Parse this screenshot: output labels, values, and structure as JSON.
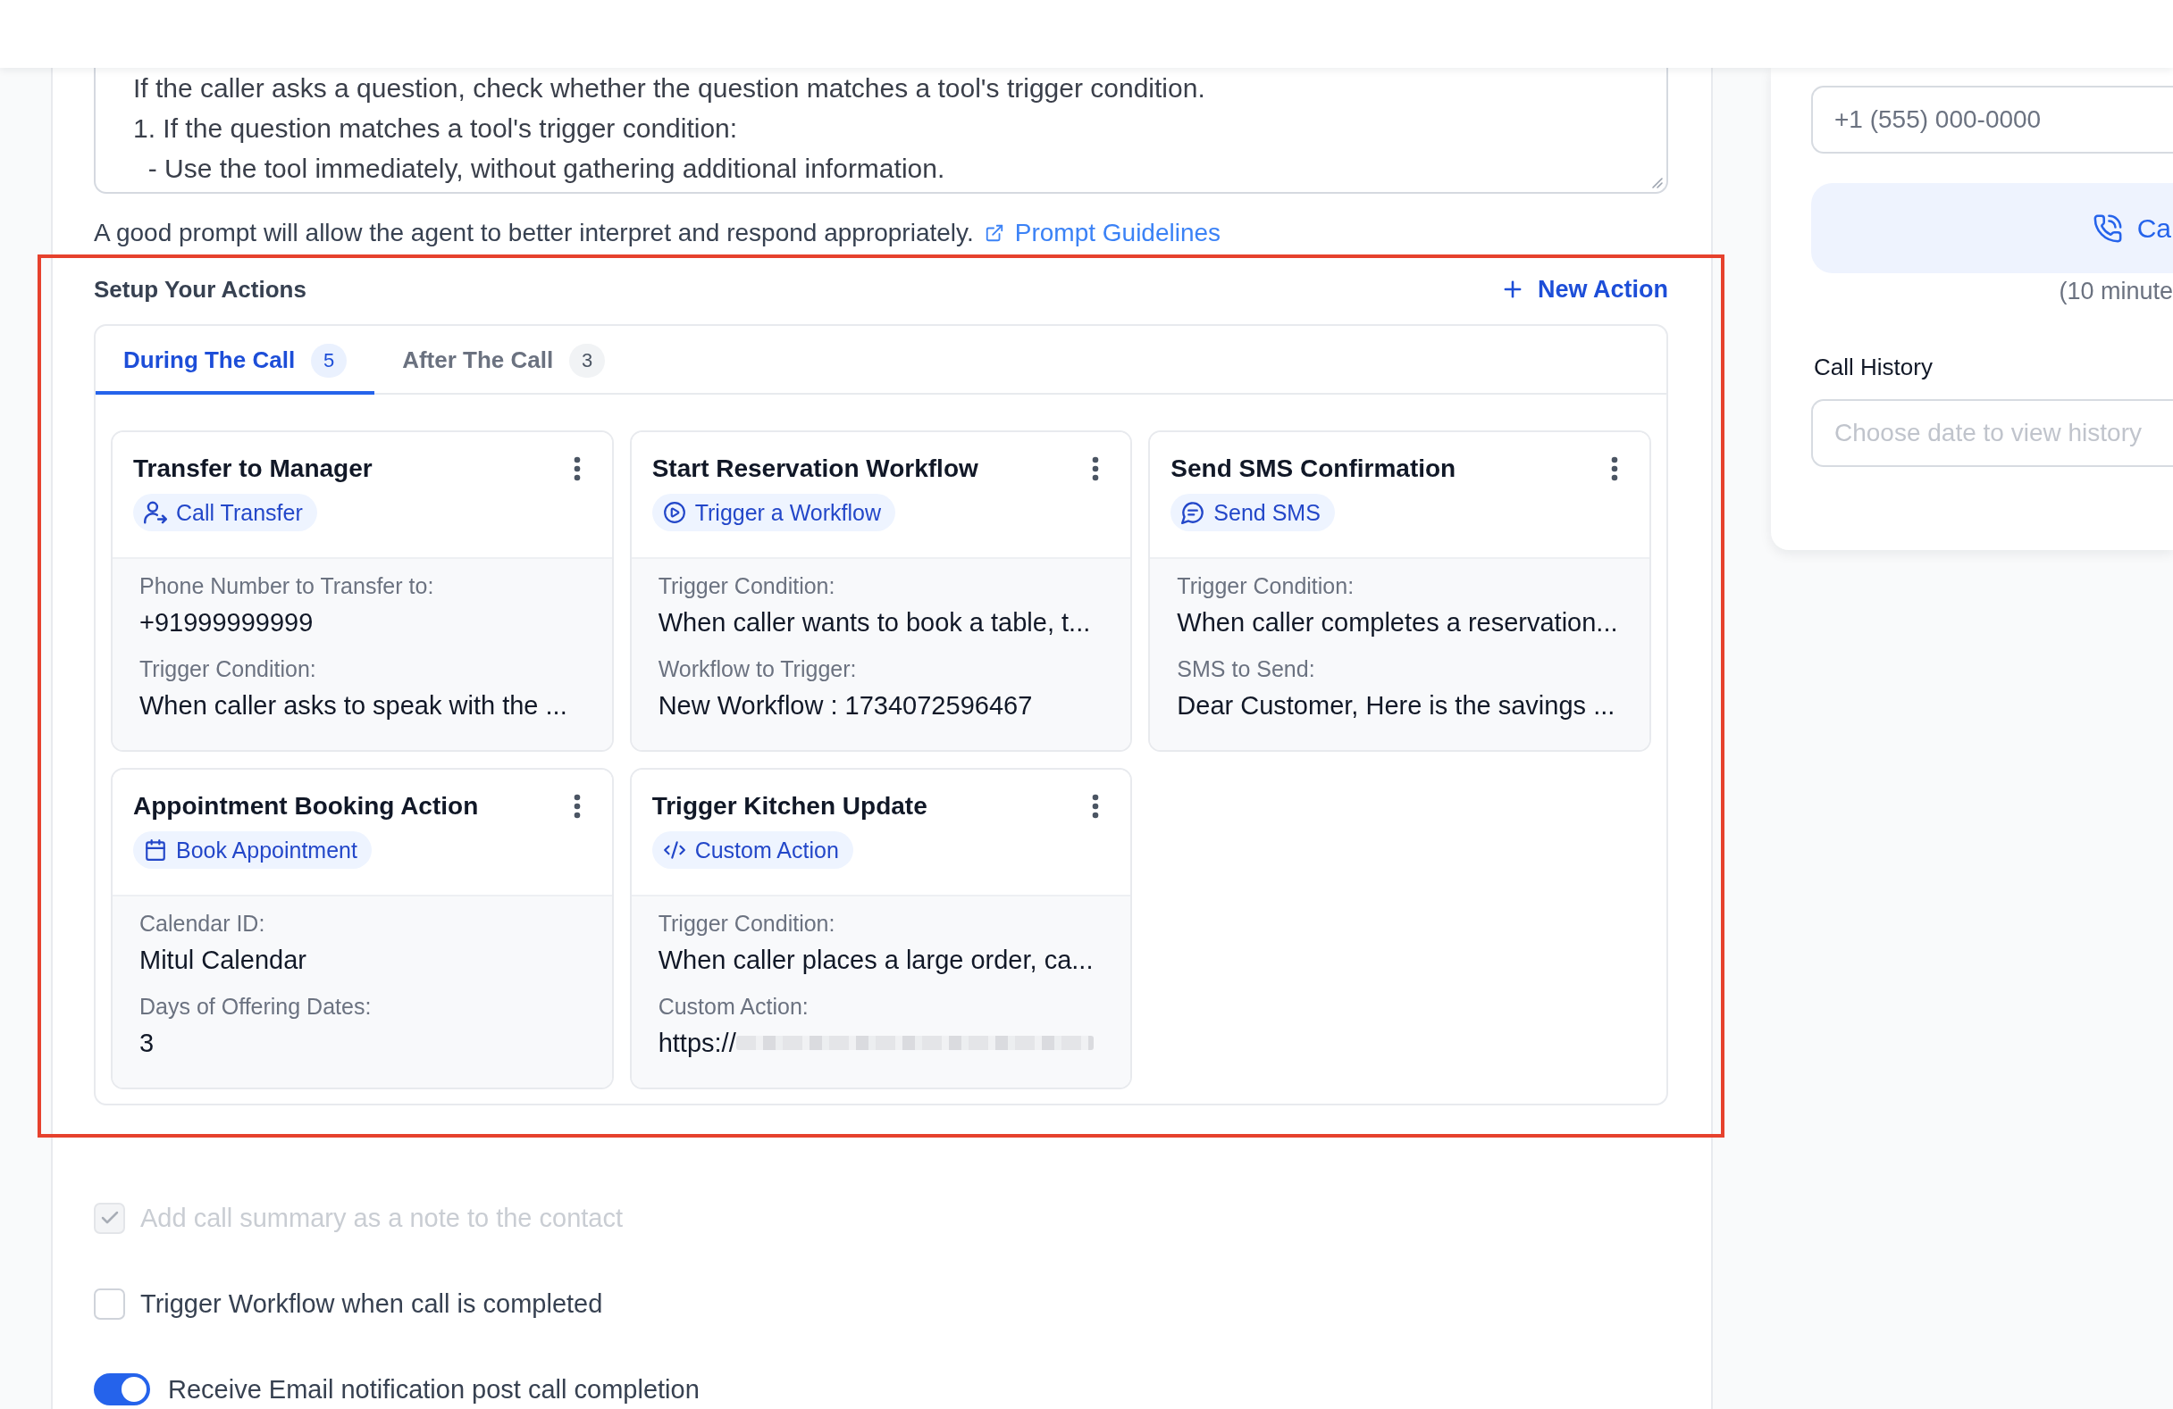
{
  "prompt": {
    "lines": [
      "If the caller asks a question, check whether the question matches a tool's trigger condition.",
      "1. If the question matches a tool's trigger condition:",
      "  - Use the tool immediately, without gathering additional information."
    ],
    "hint": "A good prompt will allow the agent to better interpret and respond appropriately.",
    "link": "Prompt Guidelines"
  },
  "actions": {
    "title": "Setup Your Actions",
    "new_action_button": "New Action",
    "tabs": [
      {
        "label": "During The Call",
        "count": "5",
        "selected": true
      },
      {
        "label": "After The Call",
        "count": "3",
        "selected": false
      }
    ],
    "cards": [
      {
        "title": "Transfer to Manager",
        "type": {
          "kind": "call_transfer",
          "label": "Call Transfer"
        },
        "fields": [
          {
            "label": "Phone Number to Transfer to:",
            "value": "+91999999999"
          },
          {
            "label": "Trigger Condition:",
            "value": "When caller asks to speak with the ..."
          }
        ]
      },
      {
        "title": "Start Reservation Workflow",
        "type": {
          "kind": "workflow",
          "label": "Trigger a Workflow"
        },
        "fields": [
          {
            "label": "Trigger Condition:",
            "value": "When caller wants to book a table, t..."
          },
          {
            "label": "Workflow to Trigger:",
            "value": "New Workflow : 1734072596467"
          }
        ]
      },
      {
        "title": "Send SMS Confirmation",
        "type": {
          "kind": "sms",
          "label": "Send SMS"
        },
        "fields": [
          {
            "label": "Trigger Condition:",
            "value": "When caller completes a reservation..."
          },
          {
            "label": "SMS to Send:",
            "value": "Dear Customer, Here is the savings ..."
          }
        ]
      },
      {
        "title": "Appointment Booking Action",
        "type": {
          "kind": "appointment",
          "label": "Book Appointment"
        },
        "fields": [
          {
            "label": "Calendar ID:",
            "value": "Mitul Calendar"
          },
          {
            "label": "Days of Offering Dates:",
            "value": "3"
          }
        ]
      },
      {
        "title": "Trigger Kitchen Update",
        "type": {
          "kind": "custom_action",
          "label": "Custom Action"
        },
        "fields": [
          {
            "label": "Trigger Condition:",
            "value": "When caller places a large order, ca..."
          },
          {
            "label": "Custom Action:",
            "value": "https://",
            "redacted": true
          }
        ]
      }
    ]
  },
  "options": [
    {
      "kind": "checkbox",
      "label": "Add call summary as a note to the contact",
      "checked": true,
      "disabled": true
    },
    {
      "kind": "checkbox",
      "label": "Trigger Workflow when call is completed",
      "checked": false,
      "disabled": false
    },
    {
      "kind": "toggle",
      "label": "Receive Email notification post call completion",
      "on": true
    }
  ],
  "test_call": {
    "phone_field": {
      "placeholder": "+1 (555) 000-0000"
    },
    "call_button": "Ca",
    "note": "(10 minute",
    "history_label": "Call History",
    "date_field": {
      "placeholder": "Choose date to view history"
    }
  }
}
